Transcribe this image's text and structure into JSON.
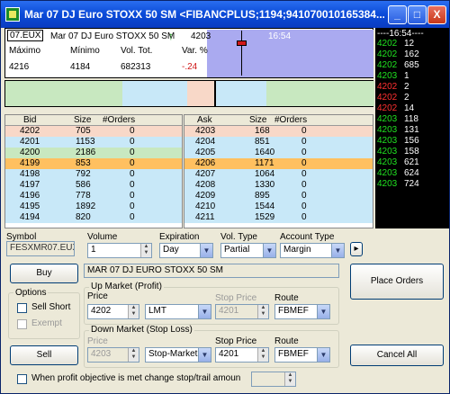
{
  "title": "Mar 07 DJ Euro STOXX 50 SM <FIBANCPLUS;1194;941070010165384...",
  "window_buttons": {
    "minimize": "_",
    "maximize": "□",
    "close": "X"
  },
  "quote": {
    "symbol_tag": "07.EUX",
    "name": "Mar 07 DJ Euro STOXX 50 SM",
    "last": "4203",
    "time": "16:54",
    "high_label": "Máximo",
    "high": "4216",
    "low_label": "Mínimo",
    "low": "4184",
    "vol_label": "Vol. Tot.",
    "vol": "682313",
    "chg_label": "Var. %",
    "chg": "-.24"
  },
  "bids": {
    "headers": [
      "Bid",
      "Size",
      "#Orders"
    ],
    "rows": [
      [
        "4202",
        "705",
        "0"
      ],
      [
        "4201",
        "1153",
        "0"
      ],
      [
        "4200",
        "2186",
        "0"
      ],
      [
        "4199",
        "853",
        "0"
      ],
      [
        "4198",
        "792",
        "0"
      ],
      [
        "4197",
        "586",
        "0"
      ],
      [
        "4196",
        "778",
        "0"
      ],
      [
        "4195",
        "1892",
        "0"
      ],
      [
        "4194",
        "820",
        "0"
      ]
    ]
  },
  "asks": {
    "headers": [
      "Ask",
      "Size",
      "#Orders"
    ],
    "rows": [
      [
        "4203",
        "168",
        "0"
      ],
      [
        "4204",
        "851",
        "0"
      ],
      [
        "4205",
        "1640",
        "0"
      ],
      [
        "4206",
        "1171",
        "0"
      ],
      [
        "4207",
        "1064",
        "0"
      ],
      [
        "4208",
        "1330",
        "0"
      ],
      [
        "4209",
        "895",
        "0"
      ],
      [
        "4210",
        "1544",
        "0"
      ],
      [
        "4211",
        "1529",
        "0"
      ]
    ]
  },
  "time_and_sales": {
    "header": "----16:54----",
    "rows": [
      [
        "4202",
        "12",
        "green"
      ],
      [
        "4202",
        "162",
        "green"
      ],
      [
        "4202",
        "685",
        "green"
      ],
      [
        "4203",
        "1",
        "green"
      ],
      [
        "4202",
        "2",
        "red"
      ],
      [
        "4202",
        "2",
        "red"
      ],
      [
        "4202",
        "14",
        "red"
      ],
      [
        "4203",
        "118",
        "green"
      ],
      [
        "4203",
        "131",
        "green"
      ],
      [
        "4203",
        "156",
        "green"
      ],
      [
        "4203",
        "158",
        "green"
      ],
      [
        "4203",
        "621",
        "green"
      ],
      [
        "4203",
        "624",
        "green"
      ],
      [
        "4203",
        "724",
        "green"
      ]
    ]
  },
  "form": {
    "symbol_label": "Symbol",
    "symbol": "FESXMR07.EUX",
    "volume_label": "Volume",
    "volume": "1",
    "expiration_label": "Expiration",
    "expiration": "Day",
    "voltype_label": "Vol. Type",
    "voltype": "Partial",
    "account_label": "Account Type",
    "account": "Margin",
    "arrow": "▸",
    "buy": "Buy",
    "sell": "Sell",
    "contract_name": "MAR 07 DJ EURO STOXX 50 SM",
    "options_label": "Options",
    "sell_short": "Sell Short",
    "exempt": "Exempt",
    "up_market_label": "Up Market (Profit)",
    "up_price_label": "Price",
    "up_price": "4202",
    "up_type": "LMT",
    "up_stop_label": "Stop Price",
    "up_stop": "4201",
    "up_route_label": "Route",
    "up_route": "FBMEF",
    "down_market_label": "Down Market (Stop Loss)",
    "down_price_label": "Price",
    "down_price": "4203",
    "down_type": "Stop-Market",
    "down_stop_label": "Stop Price",
    "down_stop": "4201",
    "down_route_label": "Route",
    "down_route": "FBMEF",
    "place_orders": "Place Orders",
    "cancel_all": "Cancel All",
    "profit_objective": "When profit objective is met change stop/trail amoun"
  },
  "colors": {
    "salmon": "#f8d8c8",
    "lightblue": "#c8e8f8",
    "lightgreen": "#c8e8c0",
    "orange": "#ffc060",
    "green": "#20e020",
    "red": "#ff3030"
  }
}
